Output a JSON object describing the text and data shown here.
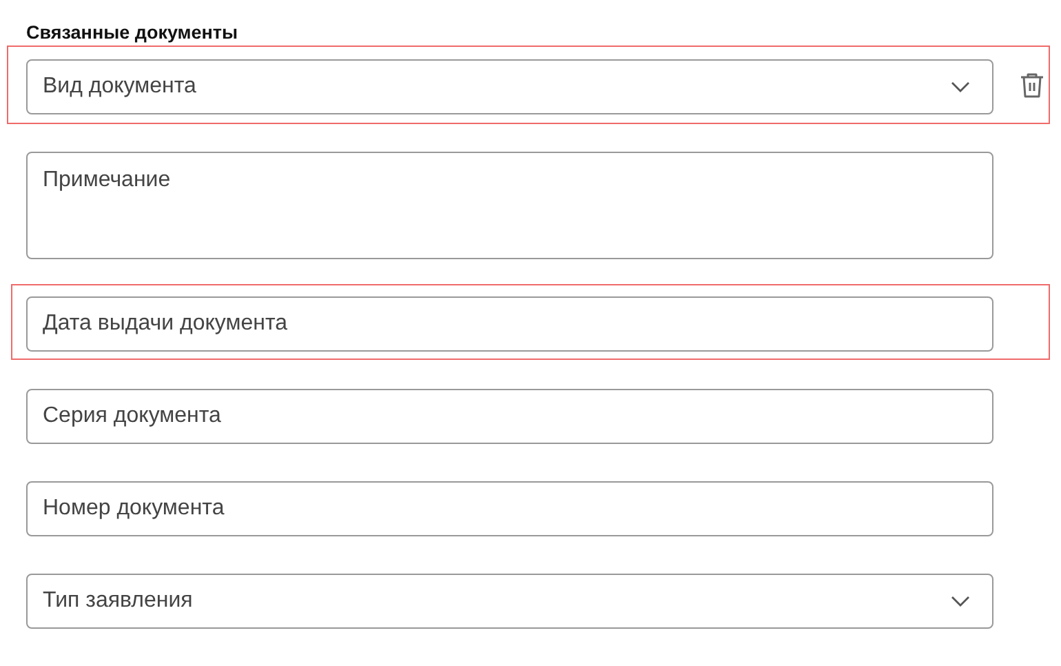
{
  "section": {
    "title": "Связанные документы"
  },
  "fields": [
    {
      "kind": "select",
      "placeholder": "Вид документа",
      "highlighted": true,
      "deletable": true
    },
    {
      "kind": "textarea",
      "placeholder": "Примечание",
      "highlighted": false,
      "deletable": false
    },
    {
      "kind": "text",
      "placeholder": "Дата выдачи документа",
      "highlighted": true,
      "deletable": false
    },
    {
      "kind": "text",
      "placeholder": "Серия документа",
      "highlighted": false,
      "deletable": false
    },
    {
      "kind": "text",
      "placeholder": "Номер документа",
      "highlighted": false,
      "deletable": false
    },
    {
      "kind": "select",
      "placeholder": "Тип заявления",
      "highlighted": false,
      "deletable": false
    }
  ]
}
